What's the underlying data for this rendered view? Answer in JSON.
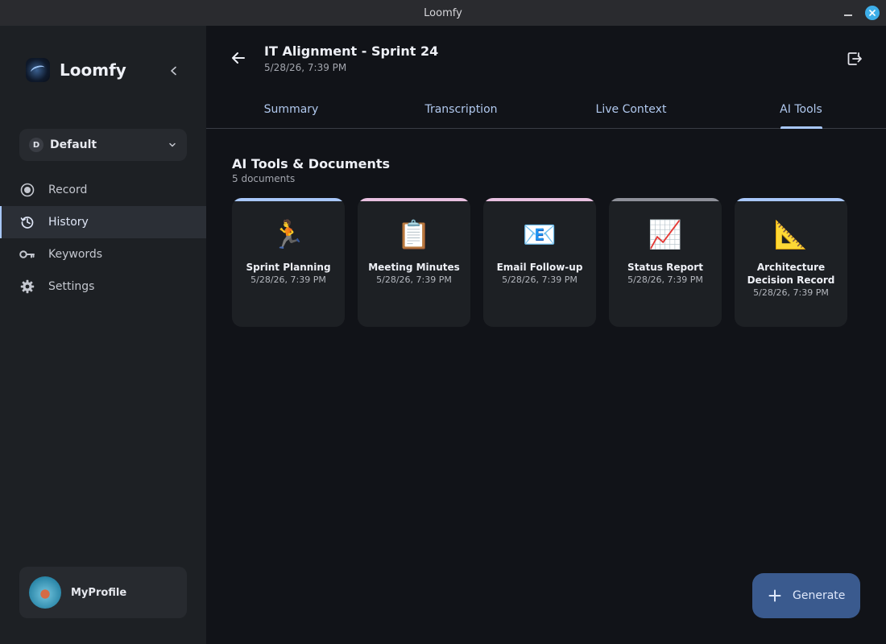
{
  "window": {
    "title": "Loomfy"
  },
  "sidebar": {
    "brand": "Loomfy",
    "workspace": {
      "badge": "D",
      "label": "Default"
    },
    "items": [
      {
        "label": "Record",
        "icon": "record-icon"
      },
      {
        "label": "History",
        "icon": "history-icon",
        "active": true
      },
      {
        "label": "Keywords",
        "icon": "key-icon"
      },
      {
        "label": "Settings",
        "icon": "gear-icon"
      }
    ],
    "profile": {
      "name": "MyProfile"
    }
  },
  "header": {
    "title": "IT Alignment - Sprint 24",
    "date": "5/28/26, 7:39 PM"
  },
  "tabs": [
    {
      "label": "Summary"
    },
    {
      "label": "Transcription"
    },
    {
      "label": "Live Context"
    },
    {
      "label": "AI Tools",
      "active": true
    }
  ],
  "section": {
    "title": "AI Tools & Documents",
    "subtitle": "5 documents"
  },
  "cards": [
    {
      "emoji": "🏃",
      "title": "Sprint Planning",
      "date": "5/28/26, 7:39 PM",
      "accent": "#a8c7fa"
    },
    {
      "emoji": "📋",
      "title": "Meeting Minutes",
      "date": "5/28/26, 7:39 PM",
      "accent": "#e8c0e0"
    },
    {
      "emoji": "📧",
      "title": "Email Follow-up",
      "date": "5/28/26, 7:39 PM",
      "accent": "#e8c0e0"
    },
    {
      "emoji": "📈",
      "title": "Status Report",
      "date": "5/28/26, 7:39 PM",
      "accent": "#8e9099"
    },
    {
      "emoji": "📐",
      "title": "Architecture Decision Record",
      "date": "5/28/26, 7:39 PM",
      "accent": "#a8c7fa"
    }
  ],
  "fab": {
    "label": "Generate"
  },
  "colors": {
    "accent": "#a8c7fa",
    "fab": "#3a5a8e",
    "sidebar_bg": "#1d2024",
    "main_bg": "#111318"
  }
}
